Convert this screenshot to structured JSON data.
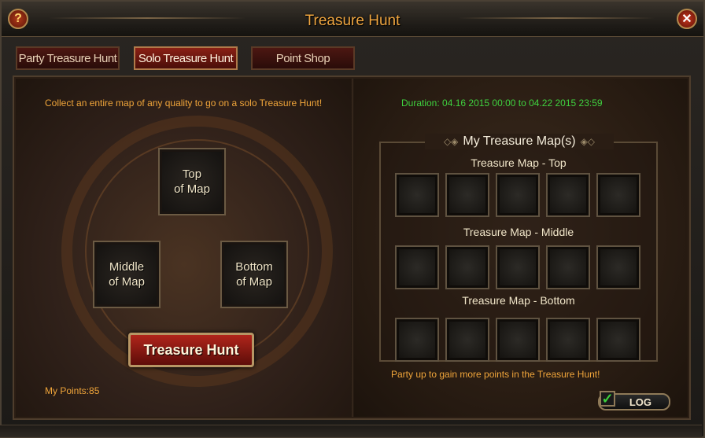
{
  "window": {
    "title": "Treasure Hunt",
    "help_glyph": "?",
    "close_glyph": "✕"
  },
  "tabs": [
    {
      "label": "Party Treasure Hunt",
      "active": false
    },
    {
      "label": "Solo Treasure Hunt",
      "active": true
    },
    {
      "label": "Point Shop",
      "active": false
    }
  ],
  "left": {
    "instruction": "Collect an entire map of any quality to go on a solo Treasure Hunt!",
    "pieces": {
      "top_line1": "Top",
      "top_line2": "of Map",
      "middle_line1": "Middle",
      "middle_line2": "of Map",
      "bottom_line1": "Bottom",
      "bottom_line2": "of Map"
    },
    "hunt_button": "Treasure Hunt",
    "points": "My Points:85"
  },
  "right": {
    "duration": "Duration: 04.16 2015 00:00 to 04.22 2015 23:59",
    "maps_title": "My Treasure Map(s)",
    "rows": [
      {
        "label": "Treasure Map - Top",
        "slots": 5
      },
      {
        "label": "Treasure Map - Middle",
        "slots": 5
      },
      {
        "label": "Treasure Map - Bottom",
        "slots": 5
      }
    ],
    "party_hint": "Party up to gain more points in the Treasure Hunt!",
    "log_label": "LOG",
    "log_checked": true
  },
  "colors": {
    "title": "#f0a640",
    "info_text": "#f0a53a",
    "duration_text": "#3fd23f",
    "active_tab": "#8a2015"
  }
}
